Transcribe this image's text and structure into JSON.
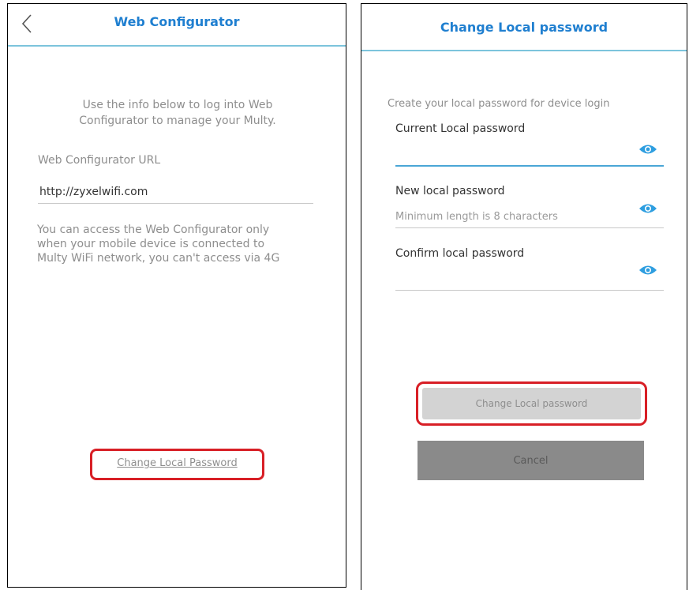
{
  "web_configurator": {
    "title": "Web Configurator",
    "intro": "Use the info below to log into Web Configurator to manage your Multy.",
    "url_label": "Web Configurator URL",
    "url_value": "http://zyxelwifi.com",
    "access_note": "You can access the Web Configurator only when your mobile device is connected to Multy WiFi network, you can't access via 4G",
    "change_password_link": "Change Local Password"
  },
  "change_password": {
    "title": "Change Local password",
    "subtitle": "Create your local password for device login",
    "fields": [
      {
        "label": "Current Local password",
        "placeholder": "",
        "value": ""
      },
      {
        "label": "New local password",
        "placeholder": "Minimum length is 8 characters",
        "value": ""
      },
      {
        "label": "Confirm local password",
        "placeholder": "",
        "value": ""
      }
    ],
    "submit_label": "Change Local password",
    "cancel_label": "Cancel"
  },
  "icons": {
    "back": "chevron-left-icon",
    "show_password": "eye-icon"
  },
  "colors": {
    "accent_blue": "#1f7fd0",
    "header_line": "#7cc4dc",
    "highlight_red": "#d81f26",
    "button_disabled": "#d3d3d3",
    "button_cancel": "#8a8a8a"
  }
}
